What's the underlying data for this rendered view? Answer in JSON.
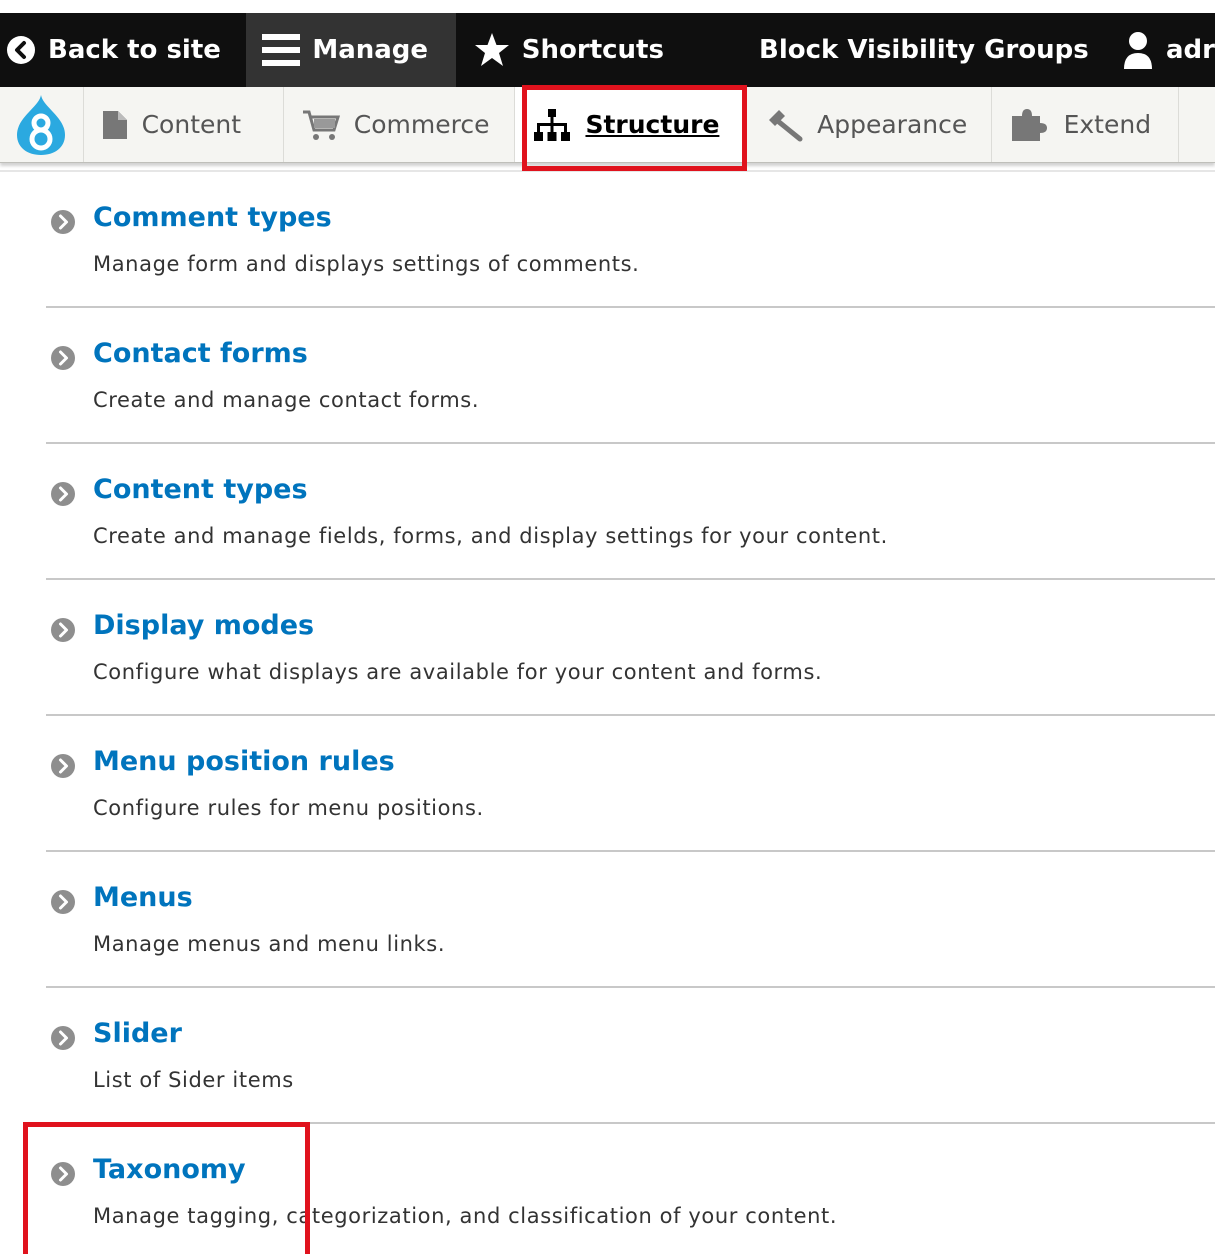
{
  "toolbar": {
    "back_label": "Back to site",
    "manage_label": "Manage",
    "shortcuts_label": "Shortcuts",
    "block_visibility_label": "Block Visibility Groups",
    "user_label": "adr"
  },
  "tray": {
    "items": [
      {
        "label": "Content",
        "icon": "file-icon"
      },
      {
        "label": "Commerce",
        "icon": "cart-icon"
      },
      {
        "label": "Structure",
        "icon": "sitemap-icon",
        "active": true
      },
      {
        "label": "Appearance",
        "icon": "paintbrush-icon"
      },
      {
        "label": "Extend",
        "icon": "puzzle-icon"
      }
    ]
  },
  "list": {
    "items": [
      {
        "title": "Comment types",
        "description": "Manage form and displays settings of comments."
      },
      {
        "title": "Contact forms",
        "description": "Create and manage contact forms."
      },
      {
        "title": "Content types",
        "description": "Create and manage fields, forms, and display settings for your content."
      },
      {
        "title": "Display modes",
        "description": "Configure what displays are available for your content and forms."
      },
      {
        "title": "Menu position rules",
        "description": "Configure rules for menu positions."
      },
      {
        "title": "Menus",
        "description": "Manage menus and menu links."
      },
      {
        "title": "Slider",
        "description": "List of Sider items"
      },
      {
        "title": "Taxonomy",
        "description": "Manage tagging, categorization, and classification of your content."
      }
    ]
  },
  "colors": {
    "toolbar_bg": "#0f0f0f",
    "manage_bg": "#333333",
    "tray_bg": "#f5f5f2",
    "link": "#0074bd",
    "highlight": "#e0121d",
    "drupal_blue": "#2ba9e0"
  }
}
